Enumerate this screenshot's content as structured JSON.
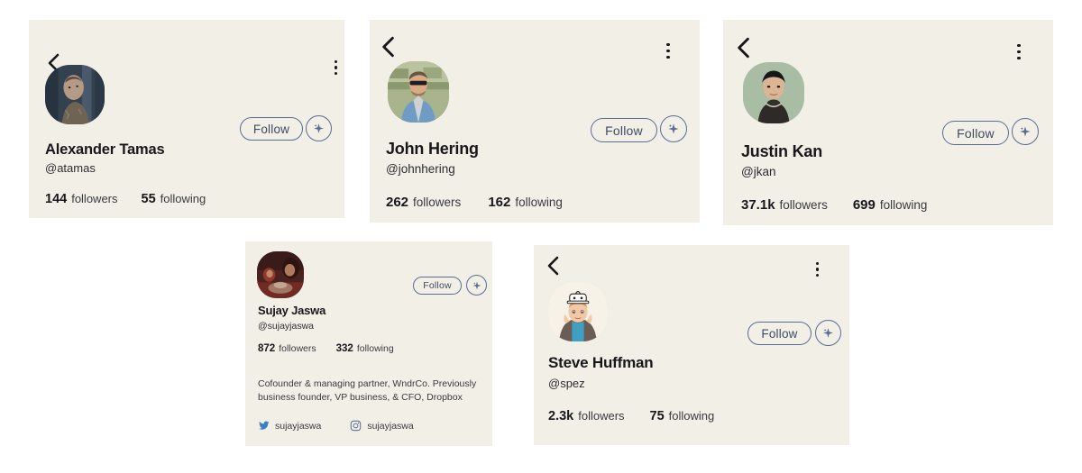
{
  "page": {
    "background_color": "#ffffff",
    "card_background_color": "#f2efe7",
    "accent_color": "#5b6c93",
    "text_color": "#18181b"
  },
  "icons": {
    "back": "chevron-left-icon",
    "menu": "three-dots-vertical-icon",
    "sparkle": "sparkle-icon",
    "twitter": "twitter-icon",
    "instagram": "instagram-icon"
  },
  "cards": [
    {
      "id": "alexander-tamas",
      "name": "Alexander Tamas",
      "handle": "@atamas",
      "follow_label": "Follow",
      "followers_count": "144",
      "followers_label": "followers",
      "following_count": "55",
      "following_label": "following",
      "avatar_description": "photo of man in front of blue-grey wall",
      "avatar_bg": "#3c4a5e",
      "has_back": true,
      "has_menu": true,
      "bio": null,
      "socials": []
    },
    {
      "id": "john-hering",
      "name": "John Hering",
      "handle": "@johnhering",
      "follow_label": "Follow",
      "followers_count": "262",
      "followers_label": "followers",
      "following_count": "162",
      "following_label": "following",
      "avatar_description": "photo of man with sunglasses in denim jacket outdoors",
      "avatar_bg": "#9aa882",
      "has_back": true,
      "has_menu": true,
      "bio": null,
      "socials": []
    },
    {
      "id": "justin-kan",
      "name": "Justin Kan",
      "handle": "@jkan",
      "follow_label": "Follow",
      "followers_count": "37.1k",
      "followers_label": "followers",
      "following_count": "699",
      "following_label": "following",
      "avatar_description": "photo of man in black turtleneck on sage green background",
      "avatar_bg": "#a9bda4",
      "has_back": true,
      "has_menu": true,
      "bio": null,
      "socials": []
    },
    {
      "id": "sujay-jaswa",
      "name": "Sujay Jaswa",
      "handle": "@sujayjaswa",
      "follow_label": "Follow",
      "followers_count": "872",
      "followers_label": "followers",
      "following_count": "332",
      "following_label": "following",
      "avatar_description": "dark reddish photo of people at a table",
      "avatar_bg": "#6b2f2c",
      "has_back": false,
      "has_menu": false,
      "bio": "Cofounder & managing partner, WndrCo. Previously business founder, VP business, & CFO, Dropbox",
      "socials": [
        {
          "network": "twitter",
          "handle": "sujayjaswa"
        },
        {
          "network": "instagram",
          "handle": "sujayjaswa"
        }
      ]
    },
    {
      "id": "steve-huffman",
      "name": "Steve Huffman",
      "handle": "@spez",
      "follow_label": "Follow",
      "followers_count": "2.3k",
      "followers_label": "followers",
      "following_count": "75",
      "following_label": "following",
      "avatar_description": "cartoon illustration of a man holding an alien hat over his head",
      "avatar_bg": "#f7f3ea",
      "has_back": true,
      "has_menu": true,
      "bio": null,
      "socials": []
    }
  ]
}
